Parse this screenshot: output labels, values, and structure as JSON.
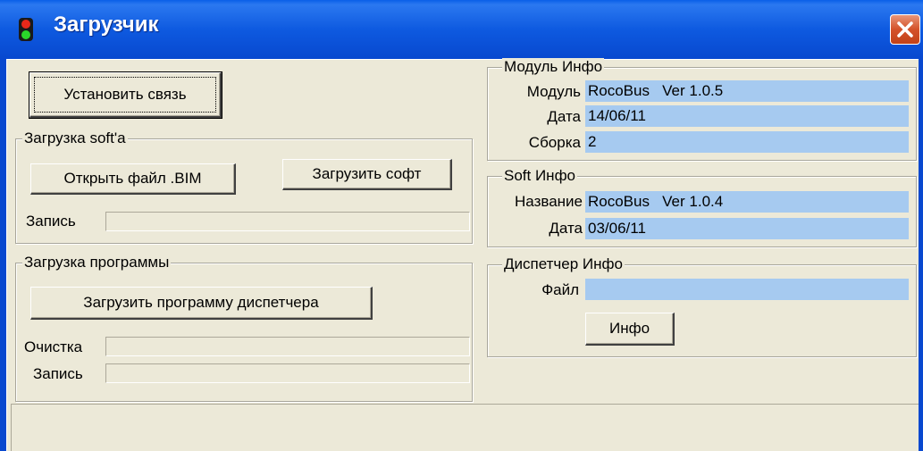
{
  "window": {
    "title": "Загрузчик",
    "accent": "#0848cf",
    "close_color": "#d4522a"
  },
  "connect": {
    "label": "Установить связь"
  },
  "soft_load": {
    "legend": "Загрузка soft'а",
    "open_label": "Открыть файл .BIM",
    "upload_label": "Загрузить софт",
    "write_label": "Запись"
  },
  "program_load": {
    "legend": "Загрузка программы",
    "upload_label": "Загрузить программу диспетчера",
    "clear_label": "Очистка",
    "write_label": "Запись"
  },
  "module_info": {
    "legend": "Модуль Инфо",
    "module_label": "Модуль",
    "module_value": "RocoBus   Ver 1.0.5",
    "date_label": "Дата",
    "date_value": "14/06/11",
    "build_label": "Сборка",
    "build_value": "2"
  },
  "soft_info": {
    "legend": "Soft Инфо",
    "name_label": "Название",
    "name_value": "RocoBus   Ver 1.0.4",
    "date_label": "Дата",
    "date_value": "03/06/11"
  },
  "dispatcher_info": {
    "legend": "Диспетчер Инфо",
    "file_label": "Файл",
    "file_value": "",
    "info_label": "Инфо"
  },
  "colors": {
    "value_bg": "#a6caf0",
    "window_bg": "#ece9d8"
  }
}
